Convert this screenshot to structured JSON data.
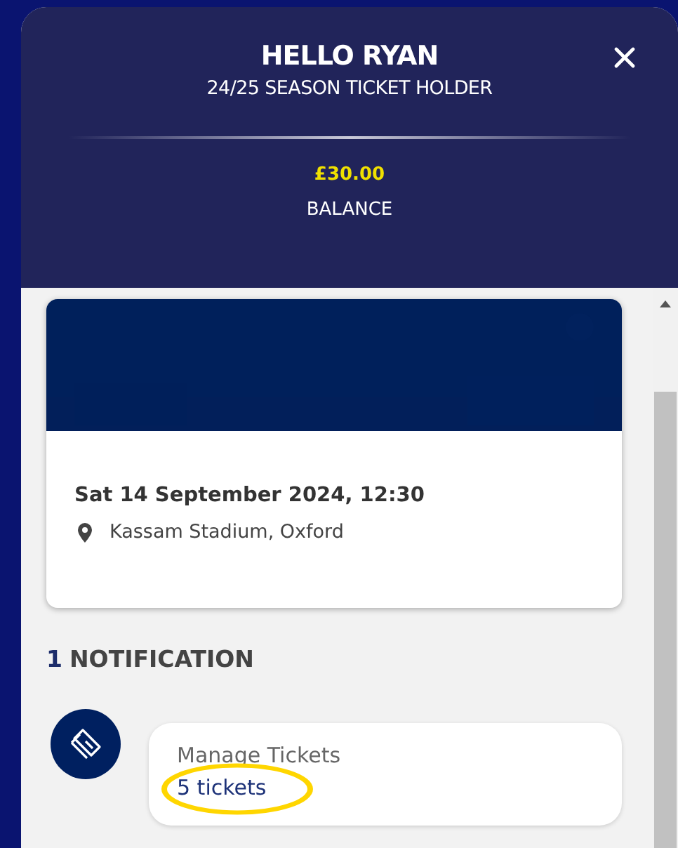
{
  "header": {
    "greeting": "HELLO RYAN",
    "subtitle": "24/25 SEASON TICKET HOLDER",
    "balance_amount": "£30.00",
    "balance_label": "BALANCE"
  },
  "event": {
    "kind": "picture",
    "date": "Sat 14 September 2024, 12:30",
    "venue": "Kassam Stadium, Oxford"
  },
  "notifications": {
    "count": "1",
    "heading": "NOTIFICATION",
    "items": [
      {
        "title": "Manage Tickets",
        "link": "5 tickets",
        "highlighted": true
      }
    ]
  }
}
